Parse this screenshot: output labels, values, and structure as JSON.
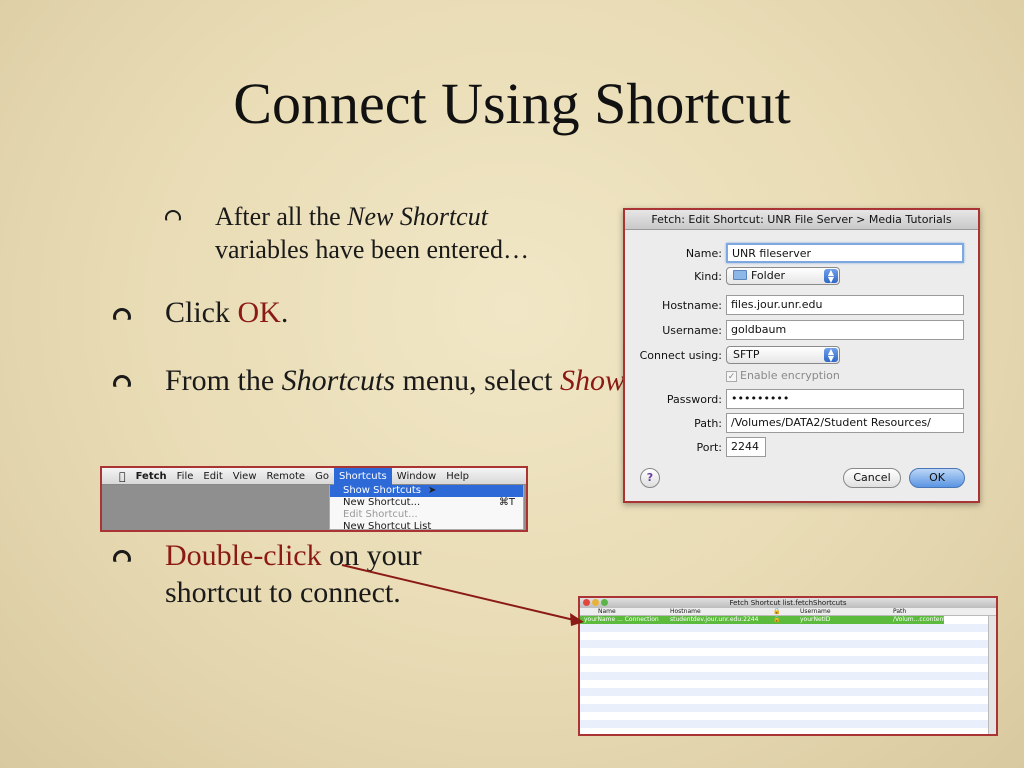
{
  "slide": {
    "title": "Connect Using Shortcut",
    "bullet1": {
      "pre": "After all the ",
      "italic": "New Shortcut",
      "post": " variables have been entered…"
    },
    "bullet2": {
      "pre": "Click ",
      "em": "OK",
      "post": "."
    },
    "bullet3": {
      "pre": "From the ",
      "italic": "Shortcuts",
      "mid": " menu, select ",
      "em_italic": "Show Shortcuts",
      "post": "."
    },
    "bullet4": {
      "em": "Double-click",
      "post": " on your shortcut to connect."
    }
  },
  "dialog": {
    "title": "Fetch: Edit Shortcut: UNR File Server > Media Tutorials",
    "name_label": "Name:",
    "name_value": "UNR fileserver",
    "kind_label": "Kind:",
    "kind_value": "Folder",
    "hostname_label": "Hostname:",
    "hostname_value": "files.jour.unr.edu",
    "username_label": "Username:",
    "username_value": "goldbaum",
    "connect_label": "Connect using:",
    "connect_value": "SFTP",
    "encryption_label": "Enable encryption",
    "password_label": "Password:",
    "password_value": "•••••••••",
    "path_label": "Path:",
    "path_value": "/Volumes/DATA2/Student Resources/",
    "port_label": "Port:",
    "port_value": "2244",
    "help_label": "?",
    "cancel_label": "Cancel",
    "ok_label": "OK"
  },
  "menubar": {
    "apple": "",
    "items": [
      "Fetch",
      "File",
      "Edit",
      "View",
      "Remote",
      "Go",
      "Shortcuts",
      "Window",
      "Help"
    ],
    "dropdown": [
      {
        "label": "Show Shortcuts",
        "key": ""
      },
      {
        "label": "New Shortcut...",
        "key": "⌘T"
      },
      {
        "label": "Edit Shortcut...",
        "key": ""
      },
      {
        "label": "New Shortcut List",
        "key": ""
      }
    ]
  },
  "shortcut_list": {
    "title": "Fetch Shortcut list.fetchShortcuts",
    "columns": [
      "Name",
      "Hostname",
      "🔒",
      "Username",
      "Path"
    ],
    "row": [
      "yourName ... Connection",
      "studentdev.jour.unr.edu:2244",
      "🔒",
      "yourNetID",
      "/Volum...ccontent"
    ]
  },
  "colors": {
    "accent_red": "#8b1a14",
    "select_blue": "#2d6ad8",
    "row_green": "#5cba3c"
  }
}
